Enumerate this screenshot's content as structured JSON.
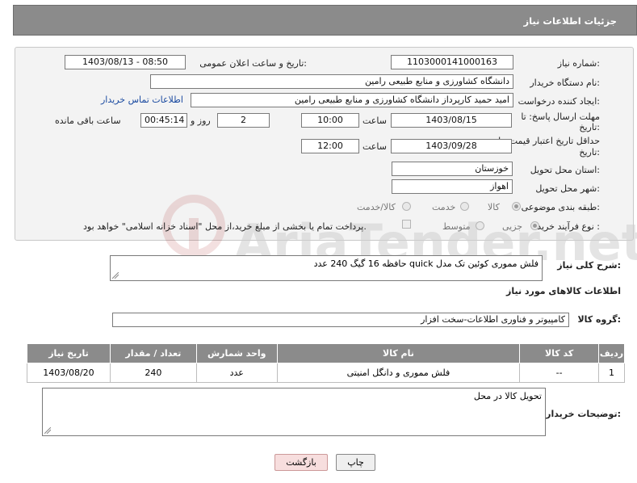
{
  "header": {
    "title": "جزئیات اطلاعات نیاز"
  },
  "form": {
    "need_number_label": "شماره نیاز:",
    "need_number": "1103000141000163",
    "announce_label": "تاریخ و ساعت اعلان عمومی:",
    "announce_value": "1403/08/13 - 08:50",
    "buyer_org_label": "نام دستگاه خریدار:",
    "buyer_org": "دانشگاه کشاورزی و منابع طبیعی رامین",
    "creator_label": "ایجاد کننده درخواست:",
    "creator": "امید حمید کارپرداز دانشگاه کشاورزی و منابع طبیعی رامین",
    "contact_link": "اطلاعات تماس خریدار",
    "deadline_label_1": "مهلت ارسال پاسخ: تا",
    "deadline_label_2": "تاریخ:",
    "deadline_date": "1403/08/15",
    "time_label": "ساعت",
    "deadline_time": "10:00",
    "days_value": "2",
    "days_label": "روز و",
    "remaining_time": "00:45:14",
    "remaining_label": "ساعت باقی مانده",
    "validity_label_1": "حداقل تاریخ اعتبار قیمت: تا",
    "validity_label_2": "تاریخ:",
    "validity_date": "1403/09/28",
    "validity_time": "12:00",
    "province_label": "استان محل تحویل:",
    "province": "خوزستان",
    "city_label": "شهر محل تحویل:",
    "city": "اهواز",
    "category_label": "طبقه بندی موضوعی:",
    "category_options": [
      "کالا",
      "خدمت",
      "کالا/خدمت"
    ],
    "purchase_type_label": "نوع فرآیند خرید :",
    "purchase_options": [
      "جزیی",
      "متوسط"
    ],
    "payment_note": "پرداخت تمام یا بخشی از مبلغ خرید،از محل \"اسناد خزانه اسلامی\" خواهد بود.",
    "description_label": "شرح کلی نیاز:",
    "description": "فلش مموری کوئین تک مدل quick حافظه 16 گیگ 240 عدد",
    "goods_info_title": "اطلاعات کالاهای مورد نیاز",
    "goods_group_label": "گروه کالا:",
    "goods_group": "کامپیوتر و فناوری اطلاعات-سخت افزار"
  },
  "table": {
    "headers": [
      "ردیف",
      "کد کالا",
      "نام کالا",
      "واحد شمارش",
      "تعداد / مقدار",
      "تاریخ نیاز"
    ],
    "rows": [
      [
        "1",
        "--",
        "فلش مموری و دانگل امنیتی",
        "عدد",
        "240",
        "1403/08/20"
      ]
    ]
  },
  "buyer_notes_label": "توضیحات خریدار:",
  "buyer_notes": "تحویل کالا در محل",
  "buttons": {
    "print": "چاپ",
    "back": "بازگشت"
  },
  "watermark_text": "AriaTender.net"
}
